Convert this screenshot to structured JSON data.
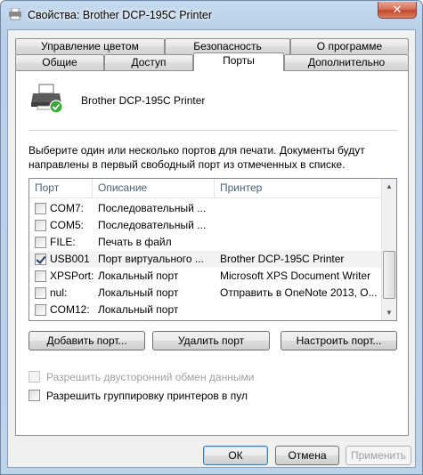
{
  "window": {
    "title": "Свойства: Brother DCP-195C Printer",
    "close_glyph": "✕"
  },
  "tabs_row1": [
    {
      "label": "Управление цветом"
    },
    {
      "label": "Безопасность"
    },
    {
      "label": "О программе"
    }
  ],
  "tabs_row2": [
    {
      "label": "Общие"
    },
    {
      "label": "Доступ"
    },
    {
      "label": "Порты"
    },
    {
      "label": "Дополнительно"
    }
  ],
  "active_tab": "Порты",
  "printer": {
    "name": "Brother DCP-195C Printer",
    "icon": "printer-icon"
  },
  "description": "Выберите один или несколько портов для печати. Документы будут направлены в первый свободный порт из отмеченных в списке.",
  "ports": {
    "headers": {
      "port": "Порт",
      "description": "Описание",
      "printer": "Принтер"
    },
    "rows": [
      {
        "port": "COM7:",
        "description": "Последовательный ...",
        "printer": "",
        "checked": false
      },
      {
        "port": "COM5:",
        "description": "Последовательный ...",
        "printer": "",
        "checked": false
      },
      {
        "port": "FILE:",
        "description": "Печать в файл",
        "printer": "",
        "checked": false
      },
      {
        "port": "USB001",
        "description": "Порт виртуального ...",
        "printer": "Brother DCP-195C Printer",
        "checked": true
      },
      {
        "port": "XPSPort:",
        "description": "Локальный порт",
        "printer": "Microsoft XPS Document Writer",
        "checked": false
      },
      {
        "port": "nul:",
        "description": "Локальный порт",
        "printer": "Отправить в OneNote 2013, O...",
        "checked": false
      },
      {
        "port": "COM12:",
        "description": "Локальный порт",
        "printer": "",
        "checked": false
      }
    ]
  },
  "buttons": {
    "add_port": "Добавить порт...",
    "delete_port": "Удалить порт",
    "configure_port": "Настроить порт...",
    "ok": "ОК",
    "cancel": "Отмена",
    "apply": "Применить"
  },
  "options": {
    "bidirectional": {
      "label": "Разрешить двусторонний обмен данными",
      "checked": false,
      "enabled": false
    },
    "pooling": {
      "label": "Разрешить группировку принтеров в пул",
      "checked": false,
      "enabled": true
    }
  },
  "colors": {
    "window_frame": "#b9d0e8",
    "close_button": "#c3462a",
    "default_button_border": "#3c7fb1"
  }
}
